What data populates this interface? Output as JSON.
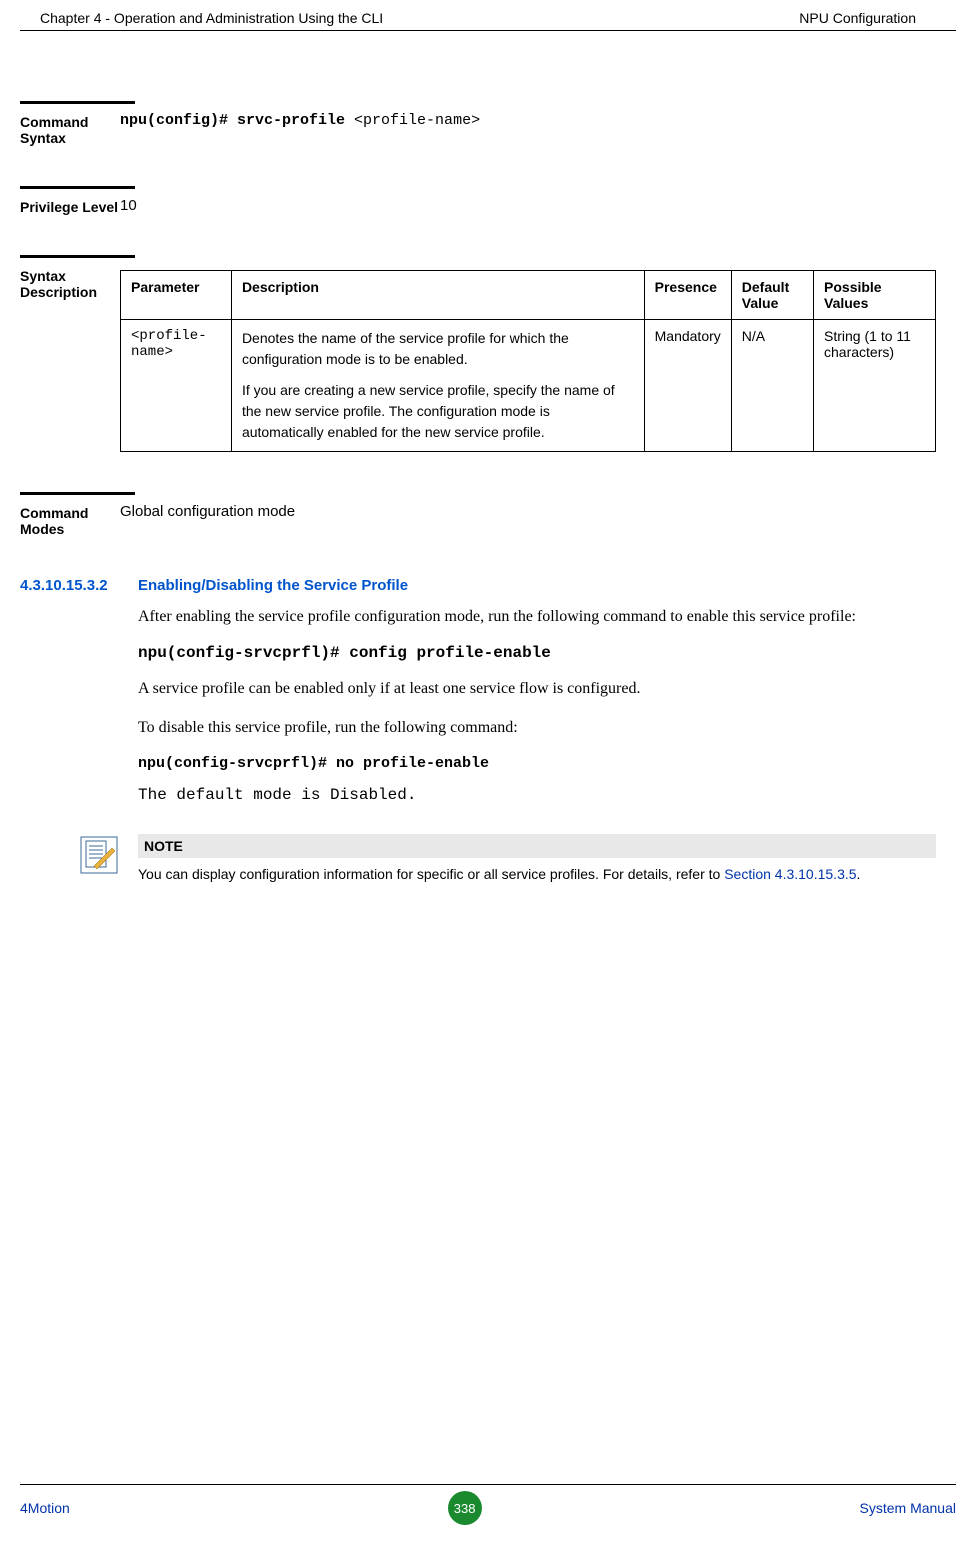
{
  "header": {
    "left": "Chapter 4 - Operation and Administration Using the CLI",
    "right": "NPU Configuration"
  },
  "commandSyntax": {
    "label": "Command Syntax",
    "prefix": "npu(config)# srvc-profile ",
    "arg": "<profile-name>"
  },
  "privilegeLevel": {
    "label": "Privilege Level",
    "value": "10"
  },
  "syntaxDescription": {
    "label": "Syntax Description",
    "headers": {
      "param": "Parameter",
      "desc": "Description",
      "presence": "Presence",
      "default": "Default Value",
      "possible": "Possible Values"
    },
    "row": {
      "param": "<profile-name>",
      "desc1": "Denotes the name of the service profile for which the configuration mode is to be enabled.",
      "desc2": "If you are creating a new service profile, specify the name of the new service profile. The configuration mode is automatically enabled for the new service profile.",
      "presence": "Mandatory",
      "default": "N/A",
      "possible": "String (1 to 11 characters)"
    }
  },
  "commandModes": {
    "label": "Command Modes",
    "value": "Global configuration mode"
  },
  "subsection": {
    "number": "4.3.10.15.3.2",
    "title": "Enabling/Disabling the Service Profile",
    "para1": "After enabling the service profile configuration mode, run the following command to enable this service profile:",
    "cmd1": "npu(config-srvcprfl)# config profile-enable",
    "para2": "A service profile can be enabled only if at least one service flow is configured.",
    "para3": "To disable this service profile, run the following command:",
    "cmd2": "npu(config-srvcprfl)# no profile-enable",
    "para4": "The default mode is Disabled."
  },
  "note": {
    "title": "NOTE",
    "text": "You can display configuration information for specific or all service profiles. For details, refer to ",
    "link": "Section 4.3.10.15.3.5",
    "after": "."
  },
  "footer": {
    "left": "4Motion",
    "page": "338",
    "right": "System Manual"
  }
}
